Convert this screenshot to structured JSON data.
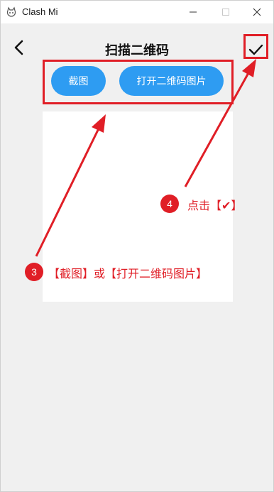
{
  "window": {
    "title": "Clash Mi"
  },
  "header": {
    "title": "扫描二维码"
  },
  "actions": {
    "screenshot_label": "截图",
    "open_qr_image_label": "打开二维码图片"
  },
  "annotations": {
    "step3_number": "3",
    "step3_text": "【截图】或【打开二维码图片】",
    "step4_number": "4",
    "step4_text": "点击【✔】",
    "color": "#e01e26"
  },
  "icons": {
    "app": "app-icon",
    "minimize": "minimize-icon",
    "maximize": "maximize-icon",
    "close": "close-icon",
    "back": "chevron-left-icon",
    "confirm": "checkmark-icon"
  },
  "colors": {
    "accent": "#2e9cf2",
    "background": "#f0f0f0",
    "annotation": "#e01e26"
  }
}
